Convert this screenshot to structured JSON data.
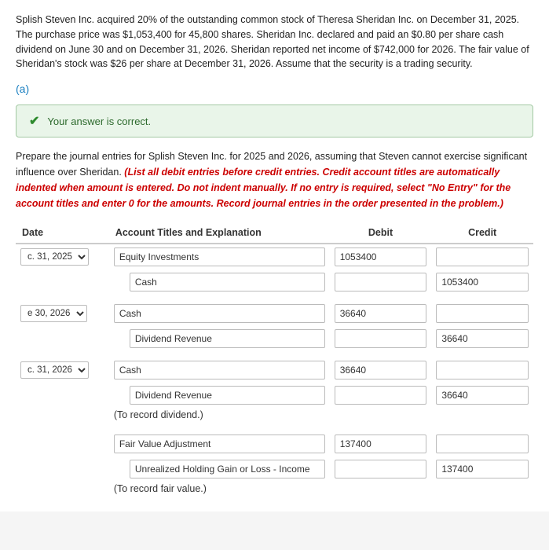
{
  "intro": {
    "text": "Splish Steven Inc. acquired 20% of the outstanding common stock of Theresa Sheridan Inc. on December 31, 2025. The purchase price was $1,053,400 for 45,800 shares. Sheridan Inc. declared and paid an $0.80 per share cash dividend on June 30 and on December 31, 2026. Sheridan reported net income of $742,000 for 2026. The fair value of Sheridan's stock was $26 per share at December 31, 2026. Assume that the security is a trading security."
  },
  "section_label": "(a)",
  "correct_banner": {
    "text": "Your answer is correct."
  },
  "instructions": {
    "prefix": "Prepare the journal entries for Splish Steven Inc. for 2025 and 2026, assuming that Steven cannot exercise significant influence over Sheridan.",
    "red": "(List all debit entries before credit entries. Credit account titles are automatically indented when amount is entered. Do not indent manually. If no entry is required, select \"No Entry\" for the account titles and enter 0 for the amounts. Record journal entries in the order presented in the problem.)"
  },
  "table": {
    "headers": {
      "date": "Date",
      "account": "Account Titles and Explanation",
      "debit": "Debit",
      "credit": "Credit"
    },
    "rows": [
      {
        "date": "c. 31, 2025",
        "show_date": true,
        "account_main": "Equity Investments",
        "debit_main": "1053400",
        "credit_main": "",
        "account_sub": "Cash",
        "debit_sub": "",
        "credit_sub": "1053400",
        "note": ""
      },
      {
        "date": "e 30, 2026",
        "show_date": true,
        "account_main": "Cash",
        "debit_main": "36640",
        "credit_main": "",
        "account_sub": "Dividend Revenue",
        "debit_sub": "",
        "credit_sub": "36640",
        "note": ""
      },
      {
        "date": "c. 31, 2026",
        "show_date": true,
        "account_main": "Cash",
        "debit_main": "36640",
        "credit_main": "",
        "account_sub": "Dividend Revenue",
        "debit_sub": "",
        "credit_sub": "36640",
        "note": "(To record dividend.)",
        "extra_main_account": "Fair Value Adjustment",
        "extra_main_debit": "137400",
        "extra_main_credit": "",
        "extra_sub_account": "Unrealized Holding Gain or Loss - Income",
        "extra_sub_debit": "",
        "extra_sub_credit": "137400",
        "extra_note": "(To record fair value.)"
      }
    ]
  }
}
